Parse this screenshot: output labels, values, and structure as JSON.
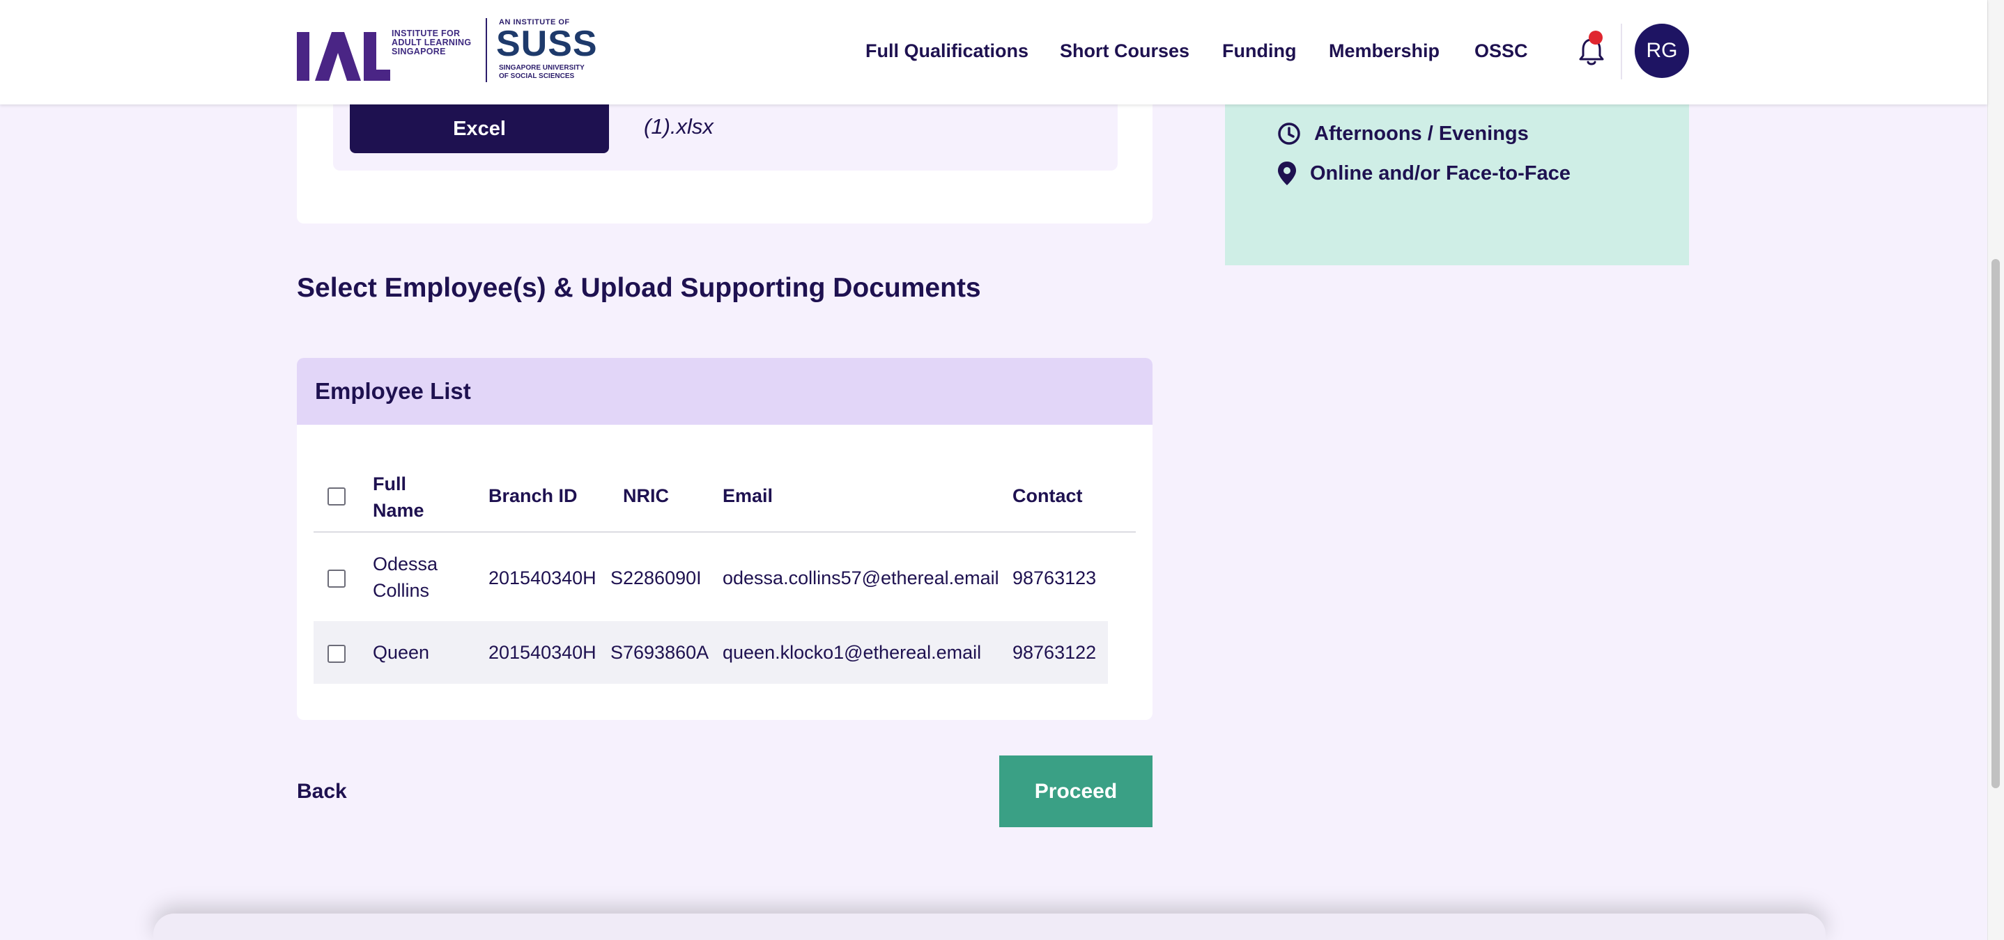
{
  "header": {
    "logo_ial_lines": [
      "INSTITUTE FOR",
      "ADULT LEARNING",
      "SINGAPORE"
    ],
    "logo_suss_tag": "AN INSTITUTE OF",
    "logo_suss_name": "SUSS",
    "logo_suss_sub_lines": [
      "SINGAPORE UNIVERSITY",
      "OF SOCIAL SCIENCES"
    ],
    "nav": [
      "Full Qualifications",
      "Short Courses",
      "Funding",
      "Membership",
      "OSSC"
    ],
    "avatar_initials": "RG",
    "notification_dot_color": "#e0262f"
  },
  "upload": {
    "button_label": "Excel",
    "file_name": "(1).xlsx"
  },
  "info": {
    "schedule": "Afternoons / Evenings",
    "mode": "Online and/or Face-to-Face"
  },
  "section_title": "Select Employee(s) & Upload Supporting Documents",
  "employee_list": {
    "title": "Employee List",
    "headers": {
      "full_name_1": "Full",
      "full_name_2": "Name",
      "branch_id": "Branch ID",
      "nric": "NRIC",
      "email": "Email",
      "contact": "Contact"
    },
    "rows": [
      {
        "name_1": "Odessa",
        "name_2": "Collins",
        "branch_id": "201540340H",
        "nric": "S2286090I",
        "email": "odessa.collins57@ethereal.email",
        "contact": "98763123"
      },
      {
        "name_1": "Queen",
        "branch_id": "201540340H",
        "nric": "S7693860A",
        "email": "queen.klocko1@ethereal.email",
        "contact": "98763122"
      }
    ]
  },
  "actions": {
    "back": "Back",
    "proceed": "Proceed"
  },
  "colors": {
    "primary_navy": "#1e1150",
    "proceed_green": "#3aa085",
    "info_card_mint": "#cfeee6",
    "list_header_lavender": "#e2d6f8"
  }
}
